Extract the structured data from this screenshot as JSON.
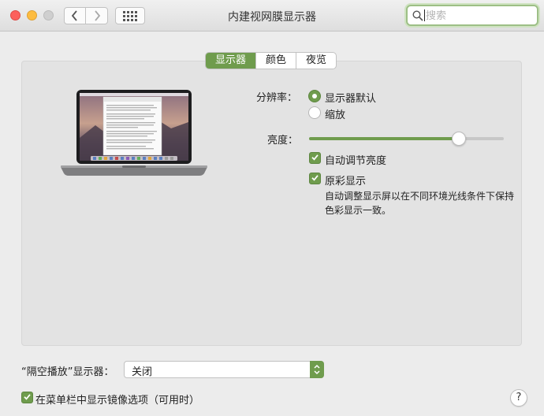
{
  "window": {
    "title": "内建视网膜显示器",
    "search_placeholder": "搜索"
  },
  "tabs": [
    {
      "label": "显示器",
      "active": true
    },
    {
      "label": "颜色",
      "active": false
    },
    {
      "label": "夜览",
      "active": false
    }
  ],
  "resolution": {
    "label": "分辨率：",
    "options": [
      {
        "label": "显示器默认",
        "selected": true
      },
      {
        "label": "缩放",
        "selected": false
      }
    ]
  },
  "brightness": {
    "label": "亮度：",
    "level": 0.77,
    "auto_label": "自动调节亮度",
    "auto_checked": true,
    "truetone_label": "原彩显示",
    "truetone_checked": true,
    "truetone_desc": "自动调整显示屏以在不同环境光线条件下保持色彩显示一致。"
  },
  "airplay": {
    "label": "“隔空播放”显示器：",
    "value": "关闭"
  },
  "mirror": {
    "label": "在菜单栏中显示镜像选项（可用时）",
    "checked": true
  },
  "help": {
    "label": "?"
  },
  "colors": {
    "accent": "#6f9c4d"
  },
  "icons": [
    "chevron-left-icon",
    "chevron-right-icon",
    "grid-icon",
    "search-icon",
    "checkmark-icon",
    "select-arrows-icon",
    "laptop-icon"
  ]
}
